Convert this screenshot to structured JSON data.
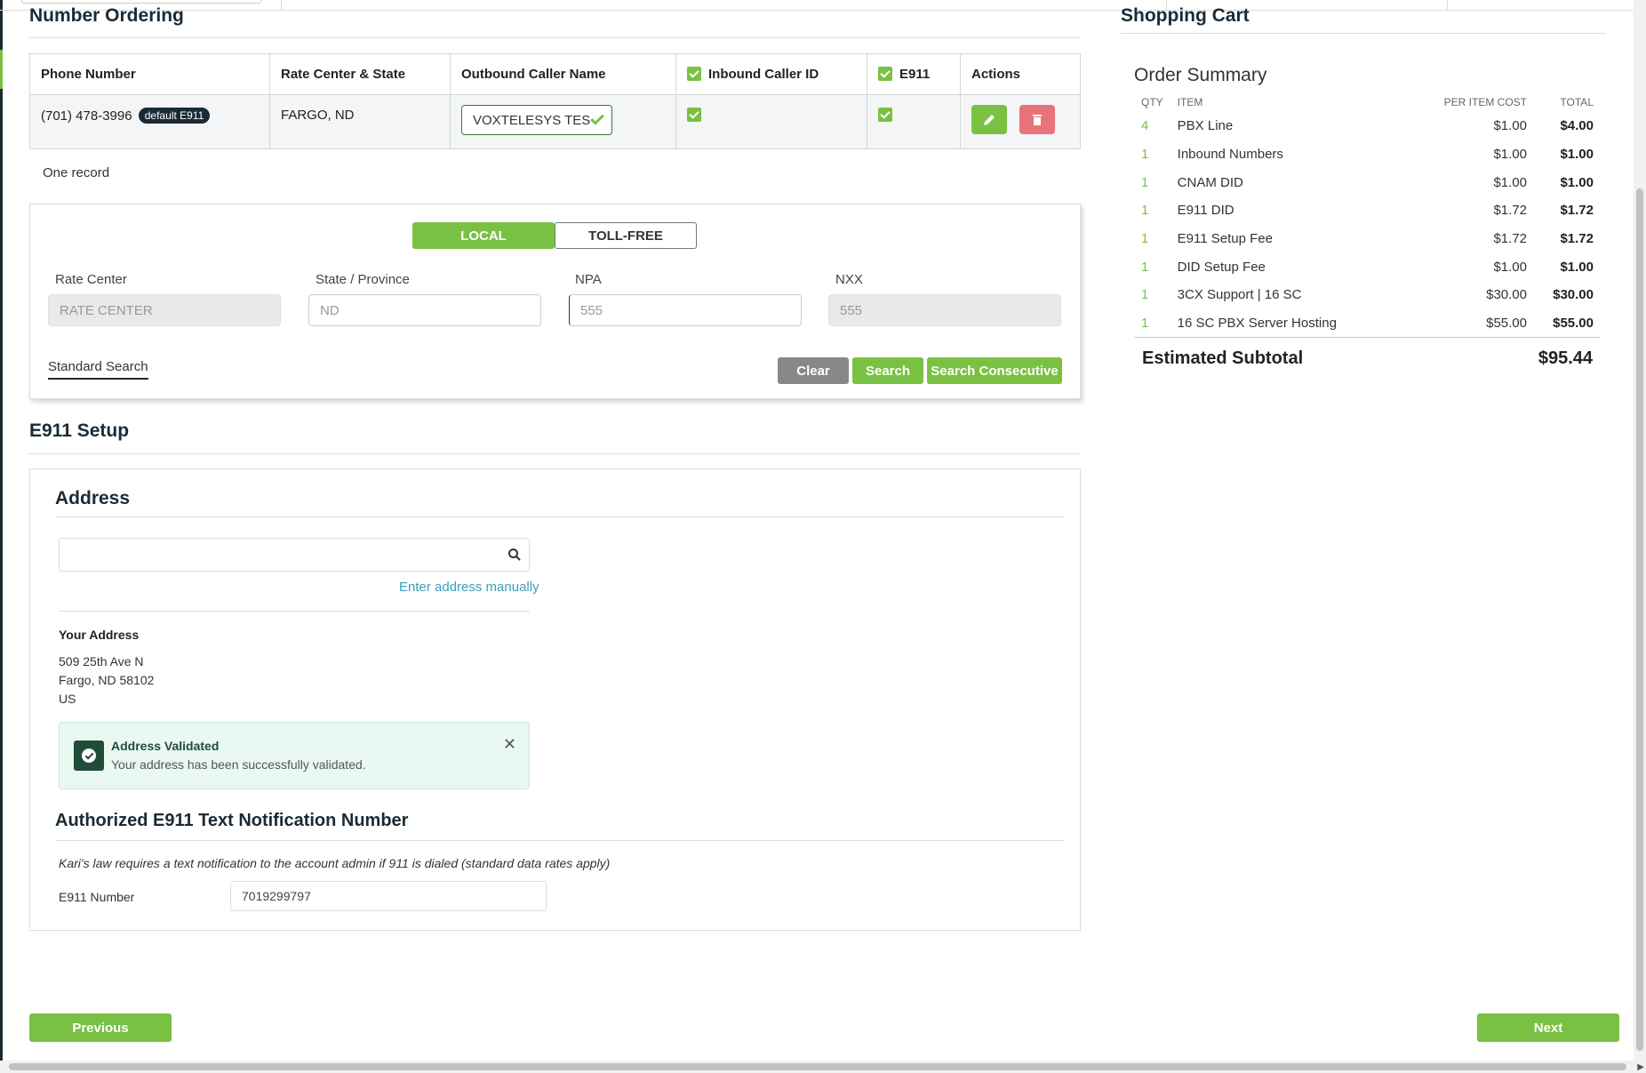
{
  "number_ordering": {
    "title": "Number Ordering",
    "columns": [
      "Phone Number",
      "Rate Center & State",
      "Outbound Caller Name",
      "Inbound Caller ID",
      "E911",
      "Actions"
    ],
    "row": {
      "phone": "(701) 478-3996",
      "badge": "default E911",
      "rate_center": "FARGO, ND",
      "caller_name": "VOXTELESYS TES"
    },
    "records_text": "One record"
  },
  "search": {
    "tabs": {
      "local": "LOCAL",
      "toll_free": "TOLL-FREE"
    },
    "labels": {
      "rate_center": "Rate Center",
      "state": "State / Province",
      "npa": "NPA",
      "nxx": "NXX"
    },
    "placeholders": {
      "rate_center": "RATE CENTER",
      "state": "ND",
      "npa": "555",
      "nxx": "555"
    },
    "standard_search": "Standard Search",
    "buttons": {
      "clear": "Clear",
      "search": "Search",
      "consecutive": "Search Consecutive"
    }
  },
  "e911": {
    "title": "E911 Setup",
    "address_title": "Address",
    "manual_link": "Enter address manually",
    "your_address_label": "Your Address",
    "address_lines": [
      "509 25th Ave N",
      "Fargo, ND 58102",
      "US"
    ],
    "alert": {
      "title": "Address Validated",
      "message": "Your address has been successfully validated.",
      "close": "✕"
    },
    "notification_title": "Authorized E911 Text Notification Number",
    "kari_text": "Kari's law requires a text notification to the account admin if 911 is dialed (standard data rates apply)",
    "number_label": "E911 Number",
    "number_value": "7019299797"
  },
  "cart": {
    "title": "Shopping Cart",
    "subtitle": "Order Summary",
    "headers": {
      "qty": "QTY",
      "item": "ITEM",
      "per_item": "PER ITEM COST",
      "total": "TOTAL"
    },
    "items": [
      {
        "qty": "4",
        "item": "PBX Line",
        "cost": "$1.00",
        "total": "$4.00"
      },
      {
        "qty": "1",
        "item": "Inbound Numbers",
        "cost": "$1.00",
        "total": "$1.00"
      },
      {
        "qty": "1",
        "item": "CNAM DID",
        "cost": "$1.00",
        "total": "$1.00"
      },
      {
        "qty": "1",
        "item": "E911 DID",
        "cost": "$1.72",
        "total": "$1.72"
      },
      {
        "qty": "1",
        "item": "E911 Setup Fee",
        "cost": "$1.72",
        "total": "$1.72"
      },
      {
        "qty": "1",
        "item": "DID Setup Fee",
        "cost": "$1.00",
        "total": "$1.00"
      },
      {
        "qty": "1",
        "item": "3CX Support | 16 SC",
        "cost": "$30.00",
        "total": "$30.00"
      },
      {
        "qty": "1",
        "item": "16 SC PBX Server Hosting",
        "cost": "$55.00",
        "total": "$55.00"
      }
    ],
    "subtotal_label": "Estimated Subtotal",
    "subtotal_value": "$95.44"
  },
  "nav": {
    "previous": "Previous",
    "next": "Next"
  },
  "colors": {
    "accent": "#7ac143",
    "dark": "#1a2b36",
    "danger": "#e8737a",
    "link": "#3aa0b8"
  }
}
